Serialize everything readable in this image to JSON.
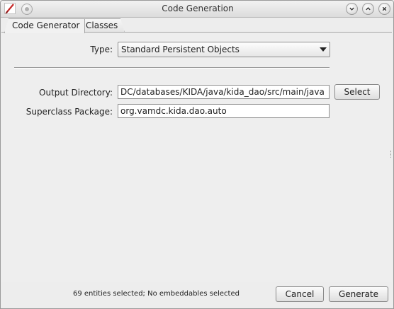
{
  "window": {
    "title": "Code Generation",
    "icons": {
      "app": "cayenne-modeler-icon",
      "menu": "window-menu-icon",
      "minimize": "minimize-icon",
      "maximize": "maximize-icon",
      "close": "close-icon"
    }
  },
  "tabs": [
    {
      "label": "Code Generator",
      "active": true
    },
    {
      "label": "Classes",
      "active": false
    }
  ],
  "form": {
    "type_label": "Type:",
    "type_value": "Standard Persistent Objects",
    "output_dir_label": "Output Directory:",
    "output_dir_value": "DC/databases/KIDA/java/kida_dao/src/main/java",
    "select_button": "Select",
    "superclass_label": "Superclass Package:",
    "superclass_value": "org.vamdc.kida.dao.auto"
  },
  "footer": {
    "status": "69 entities selected; No embeddables selected",
    "cancel_button": "Cancel",
    "generate_button": "Generate"
  },
  "colors": {
    "window_bg": "#ededed",
    "titlebar": "#dcdcdc",
    "field_bg": "#ffffff",
    "border": "#8e8e8e"
  }
}
